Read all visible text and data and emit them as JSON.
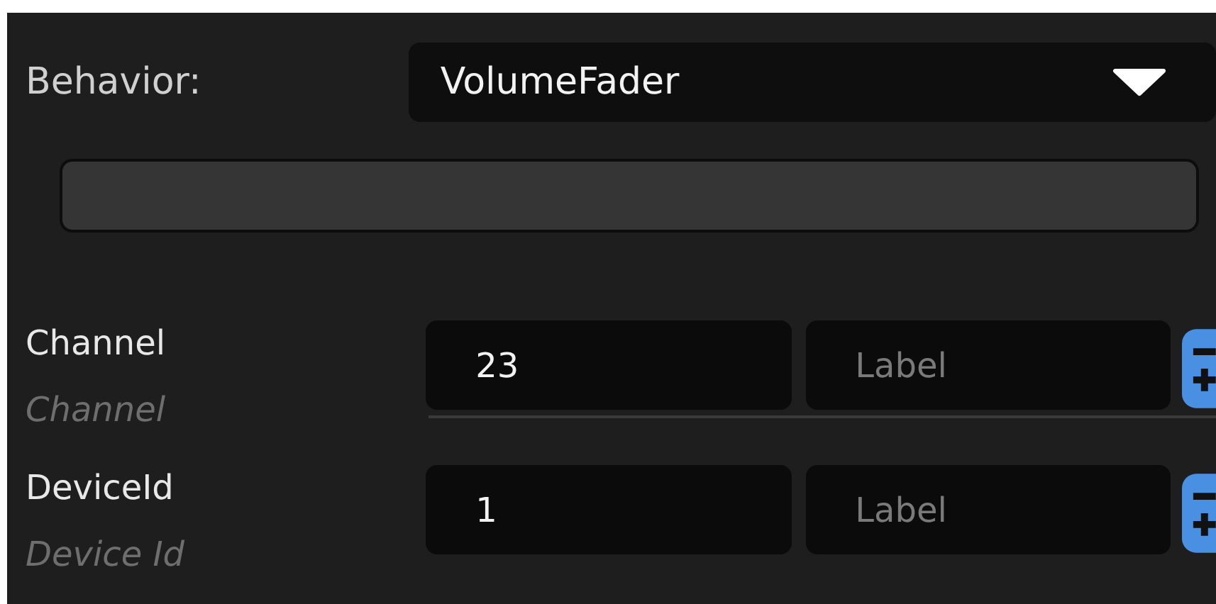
{
  "behavior": {
    "label": "Behavior:",
    "value": "VolumeFader"
  },
  "fields": [
    {
      "label": "Channel",
      "hint": "Channel",
      "value": "23",
      "placeholder": "Label"
    },
    {
      "label": "DeviceId",
      "hint": "Device Id",
      "value": "1",
      "placeholder": "Label"
    }
  ]
}
